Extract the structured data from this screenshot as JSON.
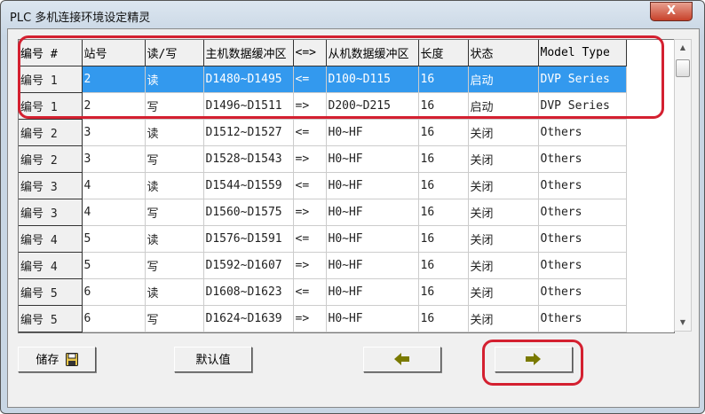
{
  "window": {
    "title": "PLC 多机连接环境设定精灵",
    "close_label": "X"
  },
  "table": {
    "headers": [
      "编号 #",
      "站号",
      "读/写",
      "主机数据缓冲区",
      "<=>",
      "从机数据缓冲区",
      "长度",
      "状态",
      "Model Type"
    ],
    "rows": [
      [
        "编号 1",
        "2",
        "读",
        "D1480~D1495",
        "<=",
        "D100~D115",
        "16",
        "启动",
        "DVP Series"
      ],
      [
        "编号 1",
        "2",
        "写",
        "D1496~D1511",
        "=>",
        "D200~D215",
        "16",
        "启动",
        "DVP Series"
      ],
      [
        "编号 2",
        "3",
        "读",
        "D1512~D1527",
        "<=",
        "H0~HF",
        "16",
        "关闭",
        "Others"
      ],
      [
        "编号 2",
        "3",
        "写",
        "D1528~D1543",
        "=>",
        "H0~HF",
        "16",
        "关闭",
        "Others"
      ],
      [
        "编号 3",
        "4",
        "读",
        "D1544~D1559",
        "<=",
        "H0~HF",
        "16",
        "关闭",
        "Others"
      ],
      [
        "编号 3",
        "4",
        "写",
        "D1560~D1575",
        "=>",
        "H0~HF",
        "16",
        "关闭",
        "Others"
      ],
      [
        "编号 4",
        "5",
        "读",
        "D1576~D1591",
        "<=",
        "H0~HF",
        "16",
        "关闭",
        "Others"
      ],
      [
        "编号 4",
        "5",
        "写",
        "D1592~D1607",
        "=>",
        "H0~HF",
        "16",
        "关闭",
        "Others"
      ],
      [
        "编号 5",
        "6",
        "读",
        "D1608~D1623",
        "<=",
        "H0~HF",
        "16",
        "关闭",
        "Others"
      ],
      [
        "编号 5",
        "6",
        "写",
        "D1624~D1639",
        "=>",
        "H0~HF",
        "16",
        "关闭",
        "Others"
      ]
    ],
    "selected_row": 0
  },
  "buttons": {
    "save": "储存",
    "default": "默认值"
  },
  "colors": {
    "selection": "#3399ee",
    "annotation": "#d42030",
    "arrow": "#7a7a00"
  }
}
